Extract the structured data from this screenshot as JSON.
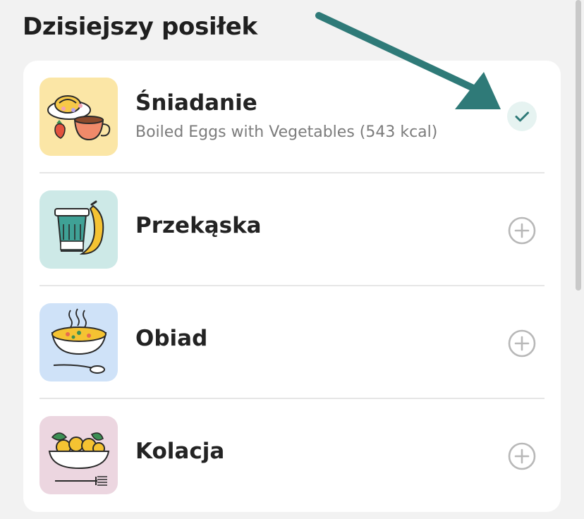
{
  "section": {
    "title": "Dzisiejszy posiłek"
  },
  "meals": [
    {
      "name": "Śniadanie",
      "subtitle": "Boiled Eggs with Vegetables (543 kcal)",
      "status": "logged",
      "icon": "breakfast-coffee-icon",
      "tile_color": "#fbe6a6"
    },
    {
      "name": "Przekąska",
      "status": "add",
      "icon": "snack-cup-banana-icon",
      "tile_color": "#cde9e7"
    },
    {
      "name": "Obiad",
      "status": "add",
      "icon": "soup-bowl-icon",
      "tile_color": "#cfe2f8"
    },
    {
      "name": "Kolacja",
      "status": "add",
      "icon": "salad-bowl-icon",
      "tile_color": "#ecd6e0"
    }
  ],
  "colors": {
    "accent_teal": "#2f7a78",
    "check_bg": "#e6f3f1",
    "add_icon": "#b8b8b8"
  }
}
